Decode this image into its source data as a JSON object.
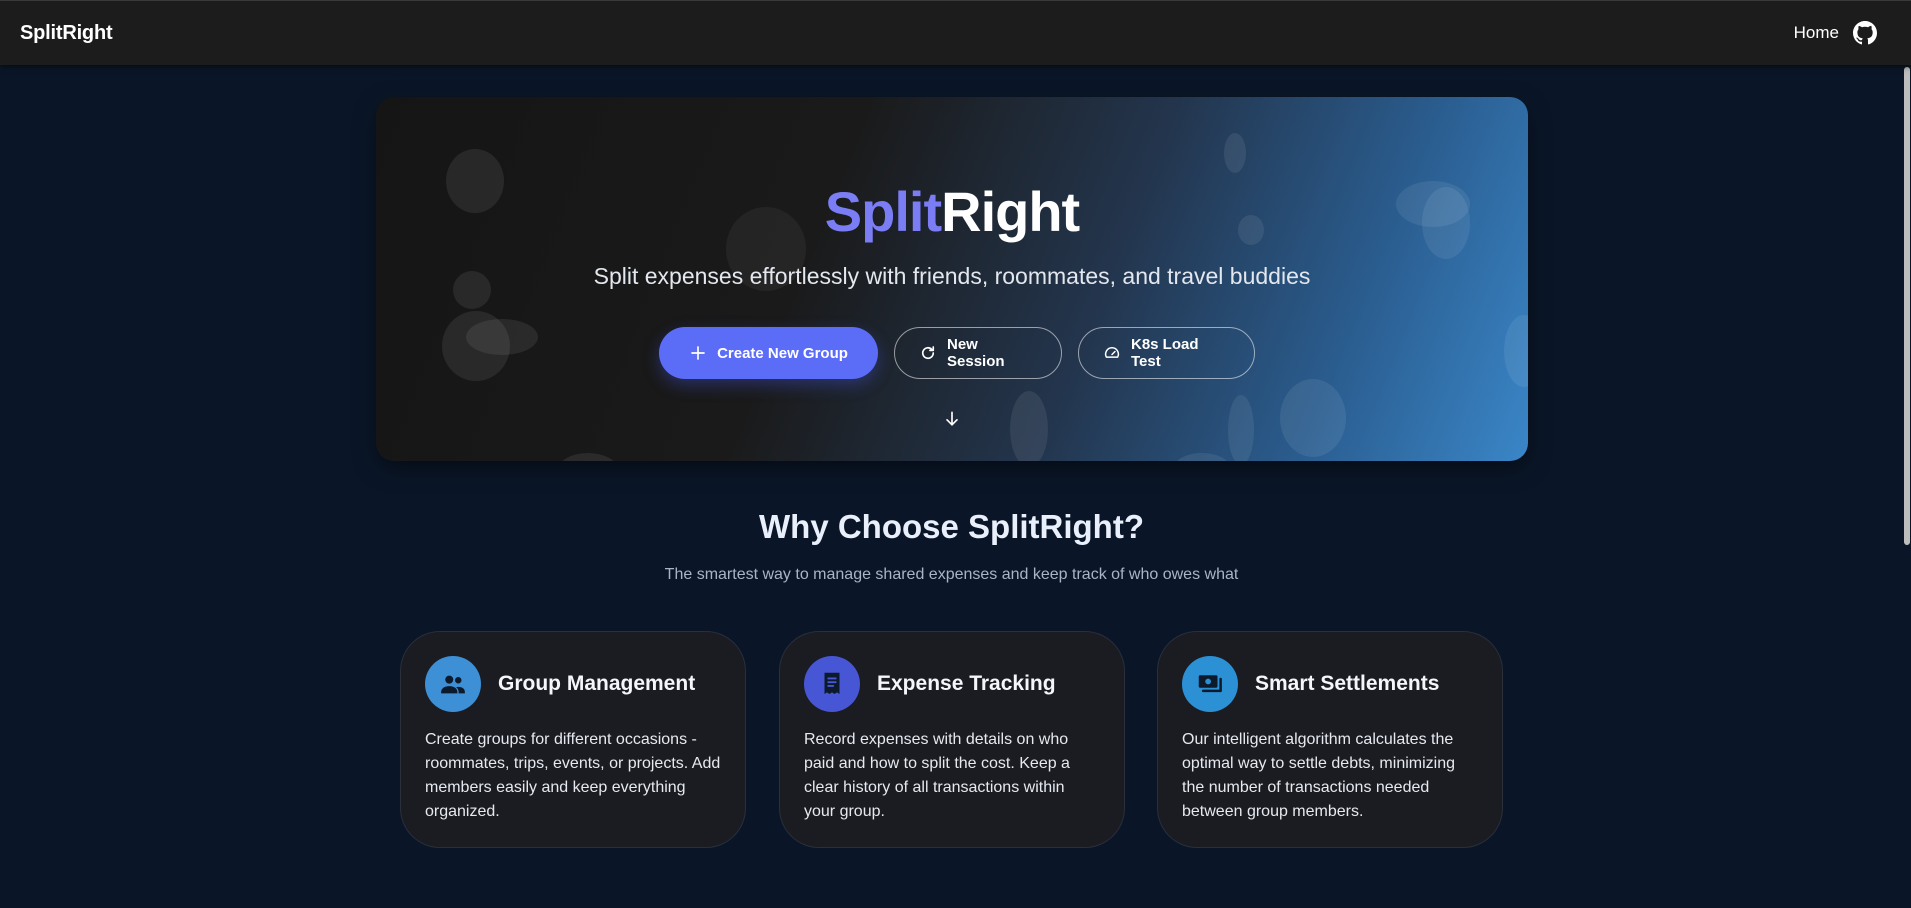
{
  "header": {
    "brand": "SplitRight",
    "nav_home": "Home",
    "github_icon": "github-icon"
  },
  "hero": {
    "title_part1": "Split",
    "title_part2": "Right",
    "subtitle": "Split expenses effortlessly with friends, roommates, and travel buddies",
    "buttons": {
      "create_group": "Create New Group",
      "new_session": "New Session",
      "load_test": "K8s Load Test"
    },
    "icons": {
      "create": "plus-icon",
      "session": "refresh-icon",
      "load": "speedometer-icon",
      "scroll": "arrow-down-icon"
    },
    "colors": {
      "accent": "#7b7df5",
      "primary_button": "#5b6cf7"
    }
  },
  "features": {
    "title": "Why Choose SplitRight?",
    "subtitle": "The smartest way to manage shared expenses and keep track of who owes what",
    "cards": [
      {
        "icon": "people-icon",
        "icon_color": "#3d8fd6",
        "title": "Group Management",
        "text": "Create groups for different occasions - roommates, trips, events, or projects. Add members easily and keep everything organized."
      },
      {
        "icon": "receipt-icon",
        "icon_color": "#4756d4",
        "title": "Expense Tracking",
        "text": "Record expenses with details on who paid and how to split the cost. Keep a clear history of all transactions within your group."
      },
      {
        "icon": "payments-icon",
        "icon_color": "#2c90d4",
        "title": "Smart Settlements",
        "text": "Our intelligent algorithm calculates the optimal way to settle debts, minimizing the number of transactions needed between group members."
      }
    ]
  }
}
